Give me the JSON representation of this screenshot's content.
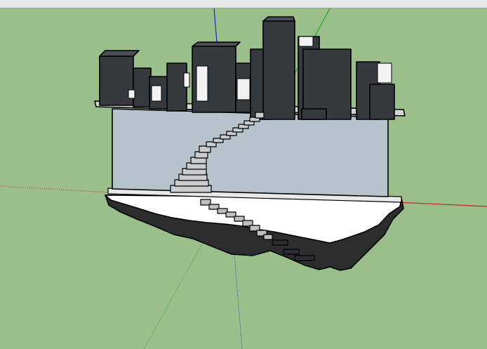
{
  "window": {
    "toolbar_strip": "toolbar-strip"
  },
  "viewport": {
    "background_color": "#9bbf8b",
    "axis_colors": {
      "red": "#cc1f1f",
      "green": "#1fa81f",
      "blue": "#1f1fcc"
    },
    "model": {
      "name": "floating-island-city",
      "building_color": "#363a3e",
      "wall_color": "#b6c3cd",
      "ground_color": "#ffffff",
      "rock_color": "#2b2d2f",
      "highlight_color": "#f2f2f2"
    }
  }
}
